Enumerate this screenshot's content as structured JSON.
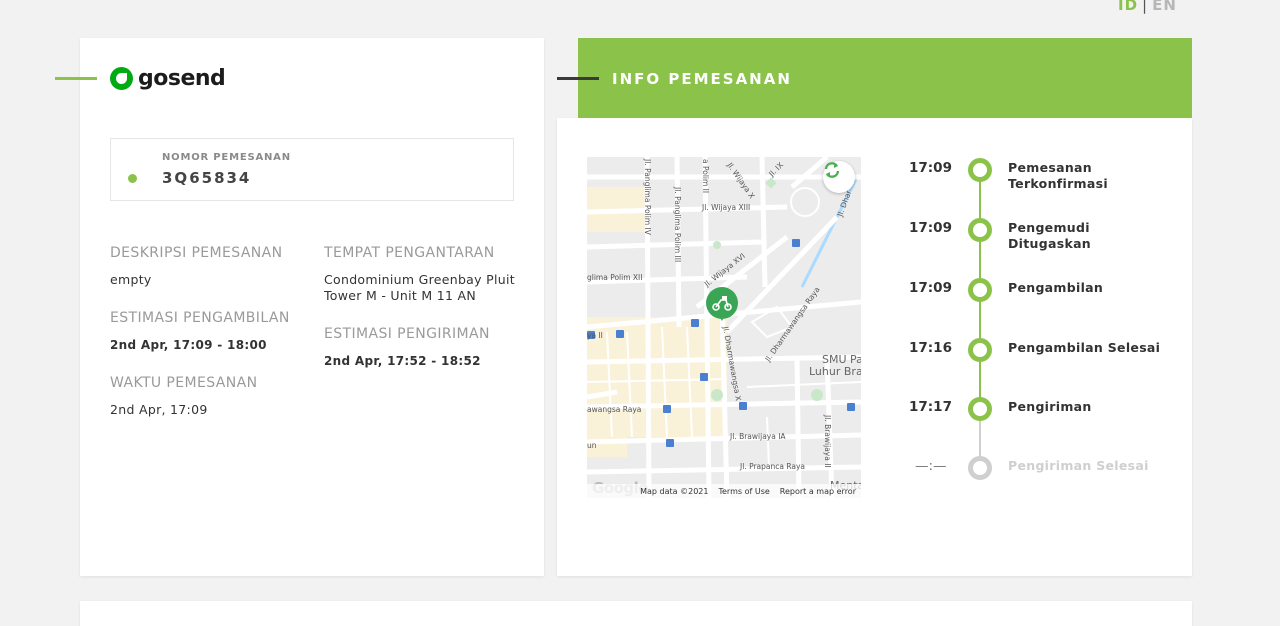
{
  "lang": {
    "id": "ID",
    "separator": "|",
    "en": "EN"
  },
  "brand": {
    "name": "gosend"
  },
  "order": {
    "label": "NOMOR PEMESANAN",
    "number": "3Q65834"
  },
  "details": {
    "description_label": "DESKRIPSI PEMESANAN",
    "description_value": "empty",
    "pickup_estimate_label": "ESTIMASI PENGAMBILAN",
    "pickup_estimate_value": "2nd Apr, 17:09 - 18:00",
    "order_time_label": "WAKTU PEMESANAN",
    "order_time_value": "2nd Apr, 17:09",
    "delivery_place_label": "TEMPAT PENGANTARAN",
    "delivery_place_line1": "Condominium Greenbay Pluit",
    "delivery_place_line2": "Tower M - Unit M 11 AN",
    "delivery_estimate_label": "ESTIMASI PENGIRIMAN",
    "delivery_estimate_value": "2nd Apr, 17:52 - 18:52"
  },
  "panel": {
    "title": "INFO PEMESANAN"
  },
  "map": {
    "google": "Google",
    "map_data": "Map data ©2021",
    "terms": "Terms of Use",
    "report": "Report a map error",
    "streets": {
      "panglima_polim_iv": "Jl. Panglima Polim IV",
      "panglima_polim_iii": "Jl. Panglima Polim III",
      "polim_ii": "a Polim II",
      "wijaya_x": "Jl. Wijaya X",
      "wijaya_xiii": "Jl. Wijaya XIII",
      "wijaya_xvi": "Jl. Wijaya XVI",
      "polim_xii": "glima Polim XII",
      "ix": "Jl. IX",
      "dharmawangsa": "Jl. Dharmawangsa Raya",
      "dharmawangsa_x": "Jl. Dharmawangsa X",
      "dhar": "Jl. Dhar",
      "smu1": "SMU Pa",
      "smu2": "Luhur Bra",
      "kebayoran_raya": "awangsa Raya",
      "brawijaya_ia": "Jl. Brawijaya IA",
      "brawijaya_ii": "Jl. Brawijaya II",
      "prapanca": "Jl. Prapanca Raya",
      "menta": "Menta",
      "ya_ii": "ya II",
      "un": "un"
    }
  },
  "timeline": [
    {
      "time": "17:09",
      "line1": "Pemesanan",
      "line2": "Terkonfirmasi"
    },
    {
      "time": "17:09",
      "line1": "Pengemudi",
      "line2": "Ditugaskan"
    },
    {
      "time": "17:09",
      "line1": "Pengambilan",
      "line2": ""
    },
    {
      "time": "17:16",
      "line1": "Pengambilan Selesai",
      "line2": ""
    },
    {
      "time": "17:17",
      "line1": "Pengiriman",
      "line2": ""
    },
    {
      "time": "—:—",
      "line1": "Pengiriman Selesai",
      "line2": ""
    }
  ],
  "colors": {
    "accent": "#8bc34a",
    "brand": "#00aa13",
    "pending": "#cfcfcf"
  }
}
